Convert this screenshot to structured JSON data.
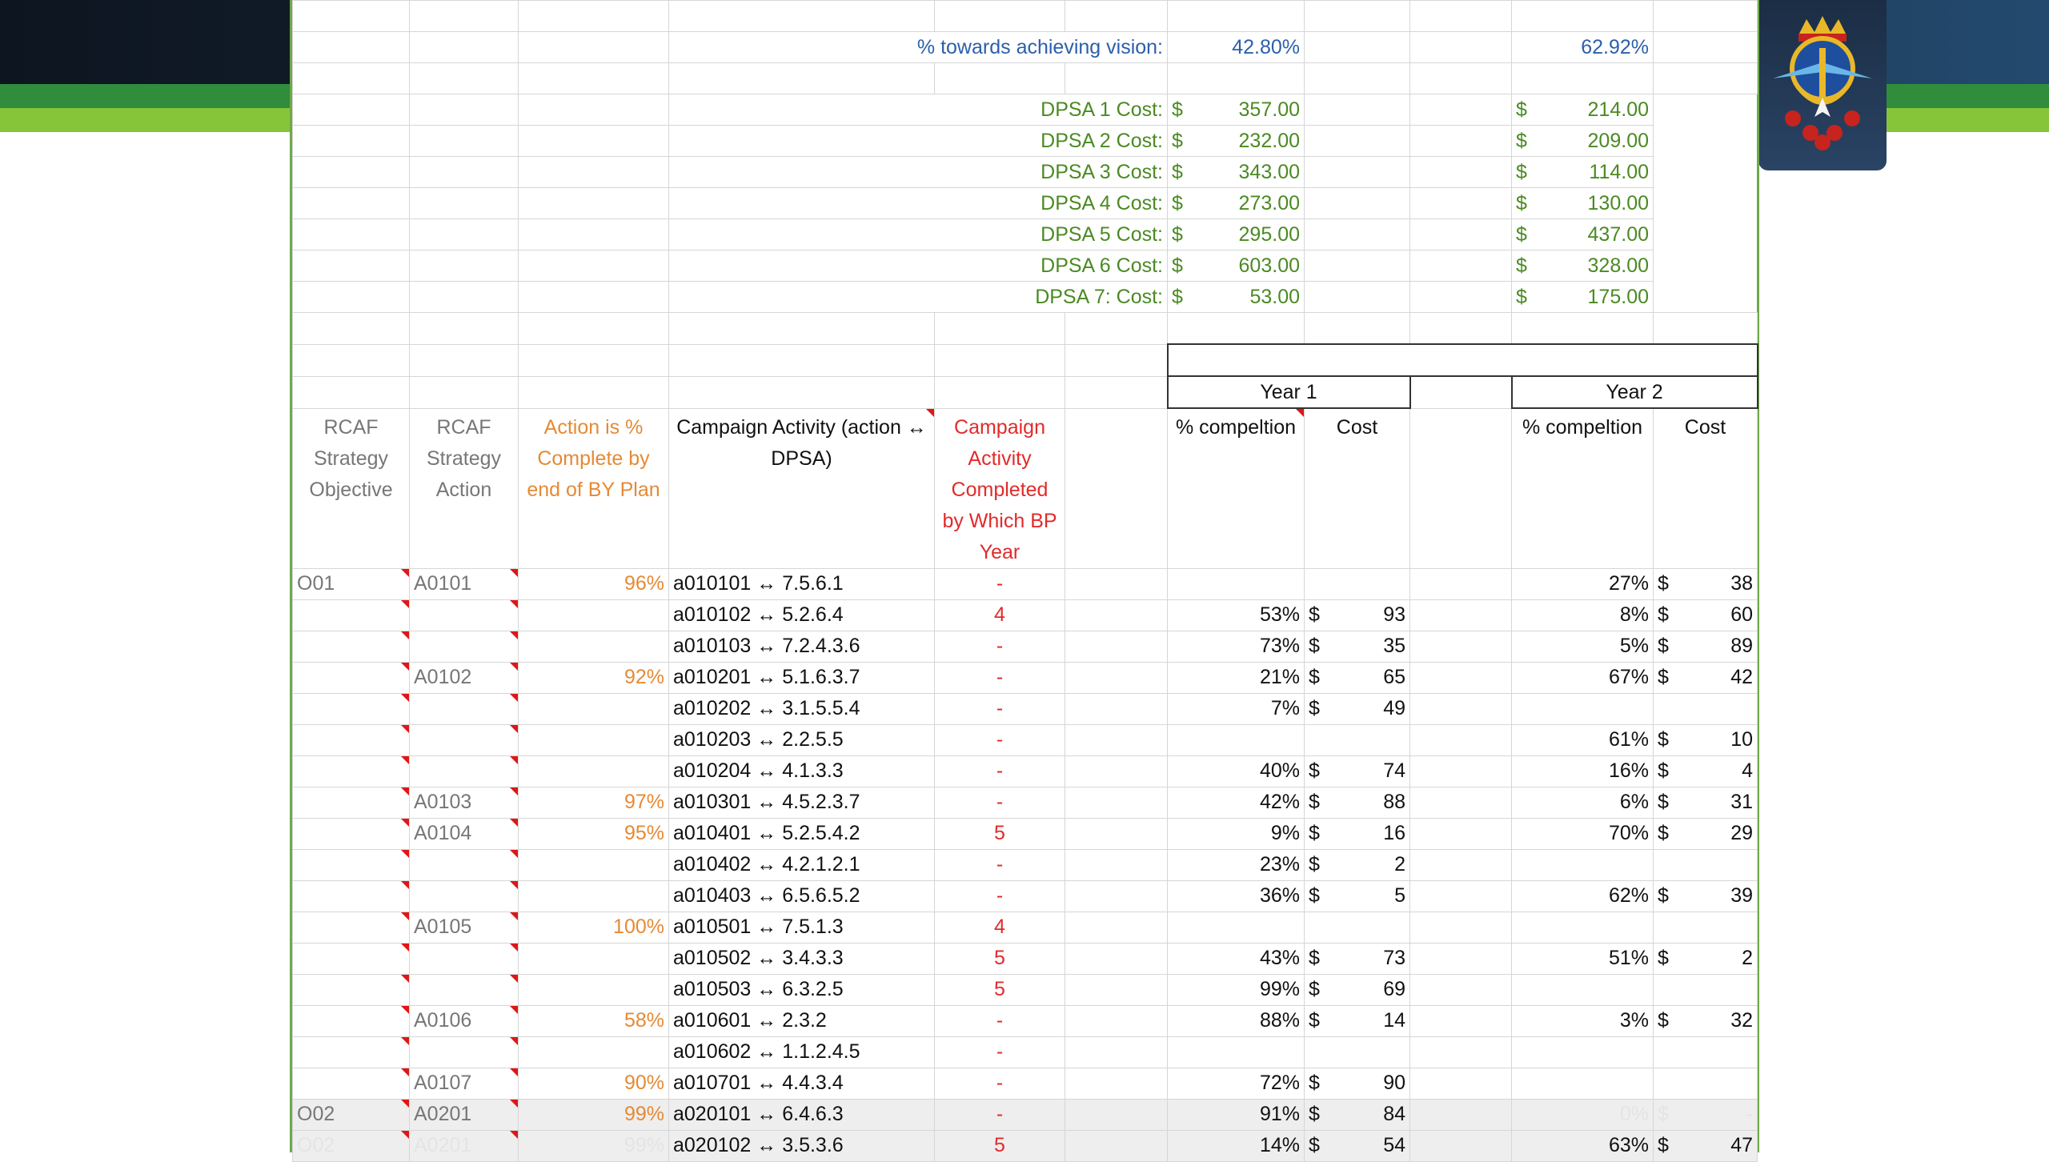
{
  "summary": {
    "vision_label": "% towards achieving vision:",
    "vision_y1": "42.80%",
    "vision_y2": "62.92%",
    "dpsa": [
      {
        "label": "DPSA 1 Cost:",
        "y1": "357.00",
        "y2": "214.00"
      },
      {
        "label": "DPSA 2 Cost:",
        "y1": "232.00",
        "y2": "209.00"
      },
      {
        "label": "DPSA 3 Cost:",
        "y1": "343.00",
        "y2": "114.00"
      },
      {
        "label": "DPSA 4 Cost:",
        "y1": "273.00",
        "y2": "130.00"
      },
      {
        "label": "DPSA 5 Cost:",
        "y1": "295.00",
        "y2": "437.00"
      },
      {
        "label": "DPSA 6 Cost:",
        "y1": "603.00",
        "y2": "328.00"
      },
      {
        "label": "DPSA 7: Cost:",
        "y1": "53.00",
        "y2": "175.00"
      }
    ],
    "currency": "$"
  },
  "years": {
    "y1": "Year 1",
    "y2": "Year 2"
  },
  "headers": {
    "objective": "RCAF Strategy Objective",
    "action": "RCAF Strategy Action",
    "pct_complete": "Action is % Complete by end of BY Plan",
    "campaign": "Campaign Activity (action ↔ DPSA)",
    "completed_by": "Campaign Activity Completed by Which BP Year",
    "y1_pct": "% compeltion",
    "y1_cost": "Cost",
    "y2_pct": "% compeltion",
    "y2_cost": "Cost"
  },
  "rows": [
    {
      "obj": "O01",
      "act": "A0101",
      "pct": "96%",
      "campaign": "a010101 ↔ 7.5.6.1",
      "done": "-",
      "y1p": "",
      "y1c": "",
      "y2p": "27%",
      "y2c": "38"
    },
    {
      "obj": "",
      "act": "",
      "pct": "",
      "campaign": "a010102 ↔ 5.2.6.4",
      "done": "4",
      "y1p": "53%",
      "y1c": "93",
      "y2p": "8%",
      "y2c": "60"
    },
    {
      "obj": "",
      "act": "",
      "pct": "",
      "campaign": "a010103 ↔ 7.2.4.3.6",
      "done": "-",
      "y1p": "73%",
      "y1c": "35",
      "y2p": "5%",
      "y2c": "89"
    },
    {
      "obj": "",
      "act": "A0102",
      "pct": "92%",
      "campaign": "a010201 ↔ 5.1.6.3.7",
      "done": "-",
      "y1p": "21%",
      "y1c": "65",
      "y2p": "67%",
      "y2c": "42"
    },
    {
      "obj": "",
      "act": "",
      "pct": "",
      "campaign": "a010202 ↔ 3.1.5.5.4",
      "done": "-",
      "y1p": "7%",
      "y1c": "49",
      "y2p": "",
      "y2c": ""
    },
    {
      "obj": "",
      "act": "",
      "pct": "",
      "campaign": "a010203 ↔ 2.2.5.5",
      "done": "-",
      "y1p": "",
      "y1c": "",
      "y2p": "61%",
      "y2c": "10"
    },
    {
      "obj": "",
      "act": "",
      "pct": "",
      "campaign": "a010204 ↔ 4.1.3.3",
      "done": "-",
      "y1p": "40%",
      "y1c": "74",
      "y2p": "16%",
      "y2c": "4"
    },
    {
      "obj": "",
      "act": "A0103",
      "pct": "97%",
      "campaign": "a010301 ↔ 4.5.2.3.7",
      "done": "-",
      "y1p": "42%",
      "y1c": "88",
      "y2p": "6%",
      "y2c": "31"
    },
    {
      "obj": "",
      "act": "A0104",
      "pct": "95%",
      "campaign": "a010401 ↔ 5.2.5.4.2",
      "done": "5",
      "y1p": "9%",
      "y1c": "16",
      "y2p": "70%",
      "y2c": "29"
    },
    {
      "obj": "",
      "act": "",
      "pct": "",
      "campaign": "a010402 ↔ 4.2.1.2.1",
      "done": "-",
      "y1p": "23%",
      "y1c": "2",
      "y2p": "",
      "y2c": ""
    },
    {
      "obj": "",
      "act": "",
      "pct": "",
      "campaign": "a010403 ↔ 6.5.6.5.2",
      "done": "-",
      "y1p": "36%",
      "y1c": "5",
      "y2p": "62%",
      "y2c": "39"
    },
    {
      "obj": "",
      "act": "A0105",
      "pct": "100%",
      "campaign": "a010501 ↔ 7.5.1.3",
      "done": "4",
      "y1p": "",
      "y1c": "",
      "y2p": "",
      "y2c": ""
    },
    {
      "obj": "",
      "act": "",
      "pct": "",
      "campaign": "a010502 ↔ 3.4.3.3",
      "done": "5",
      "y1p": "43%",
      "y1c": "73",
      "y2p": "51%",
      "y2c": "2"
    },
    {
      "obj": "",
      "act": "",
      "pct": "",
      "campaign": "a010503 ↔ 6.3.2.5",
      "done": "5",
      "y1p": "99%",
      "y1c": "69",
      "y2p": "",
      "y2c": ""
    },
    {
      "obj": "",
      "act": "A0106",
      "pct": "58%",
      "campaign": "a010601 ↔ 2.3.2",
      "done": "-",
      "y1p": "88%",
      "y1c": "14",
      "y2p": "3%",
      "y2c": "32"
    },
    {
      "obj": "",
      "act": "",
      "pct": "",
      "campaign": "a010602 ↔ 1.1.2.4.5",
      "done": "-",
      "y1p": "",
      "y1c": "",
      "y2p": "",
      "y2c": ""
    },
    {
      "obj": "",
      "act": "A0107",
      "pct": "90%",
      "campaign": "a010701 ↔ 4.4.3.4",
      "done": "-",
      "y1p": "72%",
      "y1c": "90",
      "y2p": "",
      "y2c": ""
    },
    {
      "obj": "O02",
      "act": "A0201",
      "pct": "99%",
      "campaign": "a020101 ↔ 6.4.6.3",
      "done": "-",
      "y1p": "91%",
      "y1c": "84",
      "y2p": "0%",
      "y2c": "-"
    },
    {
      "obj": "O02",
      "act": "A0201",
      "pct": "99%",
      "campaign": "a020102 ↔ 3.5.3.6",
      "done": "5",
      "y1p": "14%",
      "y1c": "54",
      "y2p": "63%",
      "y2c": "47"
    }
  ]
}
